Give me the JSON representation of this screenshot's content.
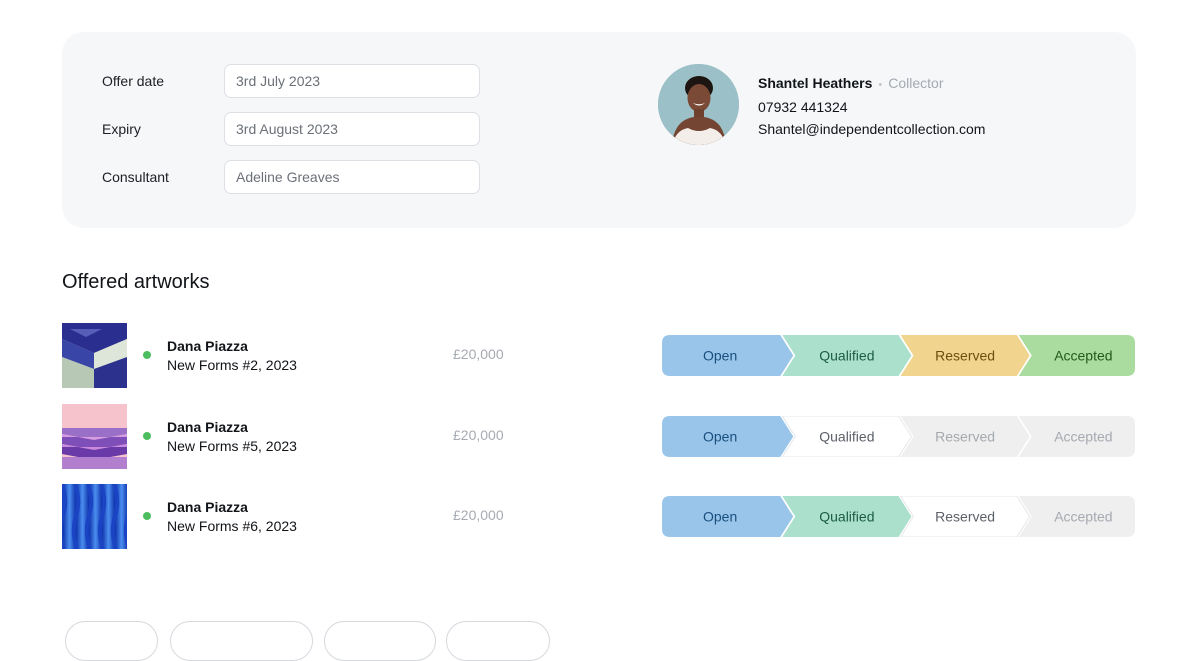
{
  "offer": {
    "fields": [
      {
        "label": "Offer date",
        "value": "3rd July 2023"
      },
      {
        "label": "Expiry",
        "value": "3rd August 2023"
      },
      {
        "label": "Consultant",
        "value": "Adeline Greaves"
      }
    ]
  },
  "contact": {
    "name": "Shantel Heathers",
    "separator": "•",
    "role": "Collector",
    "phone": "07932 441324",
    "email": "Shantel@independentcollection.com"
  },
  "section_title": "Offered artworks",
  "pipeline_stages": [
    "Open",
    "Qualified",
    "Reserved",
    "Accepted"
  ],
  "stage_colors": {
    "Open": {
      "fill": "#99c5ea",
      "text": "#1a4f7d"
    },
    "Qualified": {
      "fill": "#abe0cc",
      "text": "#1c5c47"
    },
    "Reserved": {
      "fill": "#f1d58e",
      "text": "#6d4e0e"
    },
    "Accepted": {
      "fill": "#a9dc9e",
      "text": "#235a1b"
    },
    "inactive_white": {
      "fill": "#ffffff",
      "stroke": "#e5e7eb",
      "text": "#5c6169"
    },
    "inactive_grey": {
      "fill": "#efefef",
      "text": "#a5a9b0"
    }
  },
  "artworks": [
    {
      "artist": "Dana Piazza",
      "title": "New Forms #2, 2023",
      "price": "£20,000",
      "status_color": "#4ebd5f",
      "stage_states": [
        "active",
        "active",
        "active",
        "active"
      ]
    },
    {
      "artist": "Dana Piazza",
      "title": "New Forms #5, 2023",
      "price": "£20,000",
      "status_color": "#4ebd5f",
      "stage_states": [
        "active",
        "white",
        "grey",
        "grey"
      ]
    },
    {
      "artist": "Dana Piazza",
      "title": "New Forms #6, 2023",
      "price": "£20,000",
      "status_color": "#4ebd5f",
      "stage_states": [
        "active",
        "active",
        "white",
        "grey"
      ]
    }
  ],
  "bottom_actions": [
    {
      "name": "action-pill-1"
    },
    {
      "name": "action-pill-2"
    },
    {
      "name": "action-pill-3"
    },
    {
      "name": "action-pill-4"
    }
  ]
}
